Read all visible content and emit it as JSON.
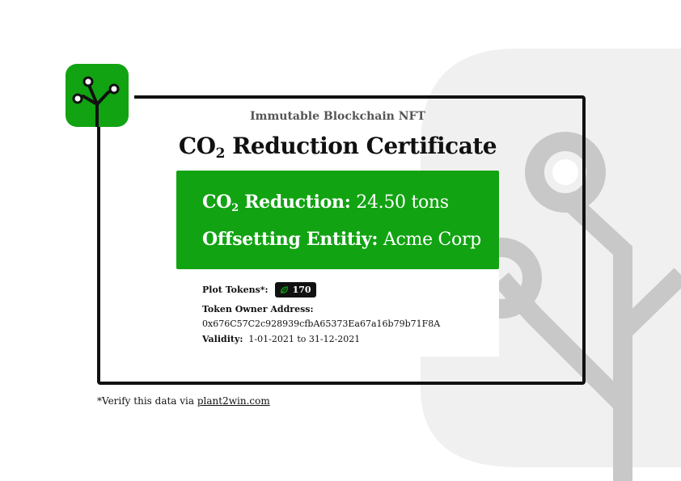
{
  "certificate": {
    "subtitle": "Immutable Blockchain NFT",
    "title_prefix": "CO",
    "title_subscript": "2",
    "title_suffix": "Reduction Certificate"
  },
  "reduction": {
    "label_prefix": "CO",
    "label_subscript": "2",
    "label_suffix": "Reduction:",
    "value": "24.50 tons"
  },
  "entity": {
    "label": "Offsetting Entitiy:",
    "value": "Acme Corp"
  },
  "details": {
    "plot_tokens_label": "Plot Tokens*:",
    "plot_tokens_value": "170",
    "owner_label": "Token Owner Address:",
    "owner_address": "0x676C57C2c928939cfbA65373Ea67a16b79b71F8A",
    "validity_label": "Validity:",
    "validity_value": "1-01-2021 to 31-12-2021"
  },
  "footer": {
    "verify_text": "*Verify this data via",
    "verify_link": "plant2win.com"
  },
  "colors": {
    "brand_green": "#12a312",
    "frame": "#111111",
    "background_art": "#f0f0f0",
    "background_art_lines": "#c8c8c8"
  },
  "icons": {
    "logo": "plant-circuit-logo-icon",
    "token": "leaf-icon"
  }
}
